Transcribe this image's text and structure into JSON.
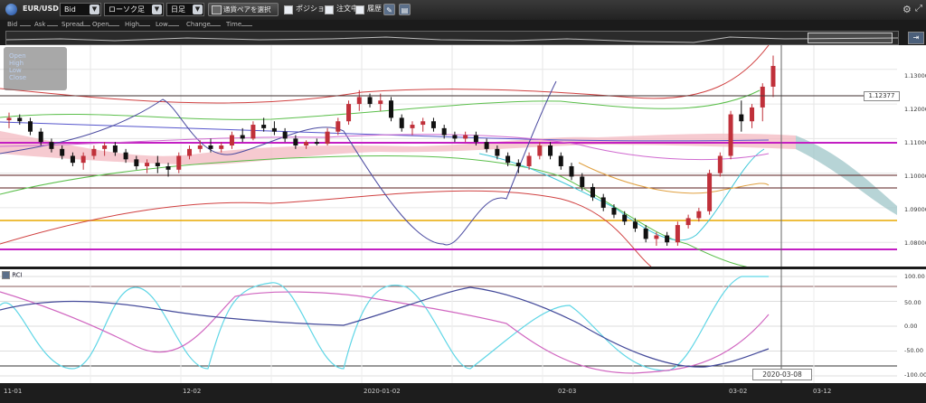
{
  "toolbar": {
    "pair": "EUR/USD",
    "price_type": "Bid",
    "chart_type": "ローソク足",
    "period": "日足",
    "pair_button": "通貨ペアを選択",
    "checkbox_position": "ポジション",
    "checkbox_orders": "注文中",
    "checkbox_history": "履歴"
  },
  "legend": [
    {
      "label": "Bid",
      "color": "#cccccc"
    },
    {
      "label": "Ask",
      "color": "#cccccc"
    },
    {
      "label": "Spread",
      "color": "#cccccc"
    },
    {
      "label": "Open",
      "color": "#cccccc"
    },
    {
      "label": "High",
      "color": "#cccccc"
    },
    {
      "label": "Low",
      "color": "#cccccc"
    },
    {
      "label": "Change",
      "color": "#cccccc"
    },
    {
      "label": "Time",
      "color": "#cccccc"
    }
  ],
  "ohlc_box": {
    "open": "Open",
    "high": "High",
    "low": "Low",
    "close": "Close"
  },
  "main_yaxis": [
    "1.13000",
    "1.12000",
    "1.11000",
    "1.10000",
    "1.09000",
    "1.08000"
  ],
  "current_price": "1.12377",
  "rci": {
    "label": "RCI",
    "yaxis": [
      "100.00",
      "50.00",
      "0.00",
      "-50.00",
      "-100.00"
    ]
  },
  "xaxis": [
    "11-01",
    "12-02",
    "2020-01-02",
    "02-03",
    "03-02",
    "03-12"
  ],
  "crosshair_date": "2020-03-08",
  "colors": {
    "up": "#c0303a",
    "down": "#111111",
    "cloud_pos": "#f3b8c0",
    "cloud_neg": "#9fc6c8",
    "hline_magenta": "#c31fc3",
    "hline_orange": "#e8a800",
    "hline_dark": "#5a1e1e"
  },
  "chart_data": {
    "type": "candlestick",
    "ylim": [
      1.073,
      1.137
    ],
    "candles": [
      [
        1.1153,
        1.1175,
        1.113,
        1.116
      ],
      [
        1.116,
        1.117,
        1.114,
        1.115
      ],
      [
        1.115,
        1.116,
        1.111,
        1.112
      ],
      [
        1.112,
        1.113,
        1.108,
        1.109
      ],
      [
        1.109,
        1.11,
        1.106,
        1.107
      ],
      [
        1.107,
        1.108,
        1.104,
        1.105
      ],
      [
        1.105,
        1.106,
        1.102,
        1.103
      ],
      [
        1.103,
        1.106,
        1.101,
        1.105
      ],
      [
        1.105,
        1.108,
        1.104,
        1.107
      ],
      [
        1.107,
        1.109,
        1.105,
        1.108
      ],
      [
        1.108,
        1.109,
        1.105,
        1.106
      ],
      [
        1.106,
        1.107,
        1.103,
        1.104
      ],
      [
        1.104,
        1.105,
        1.101,
        1.102
      ],
      [
        1.102,
        1.104,
        1.1,
        1.103
      ],
      [
        1.103,
        1.105,
        1.1,
        1.102
      ],
      [
        1.102,
        1.103,
        1.099,
        1.101
      ],
      [
        1.101,
        1.106,
        1.1,
        1.105
      ],
      [
        1.105,
        1.108,
        1.104,
        1.107
      ],
      [
        1.107,
        1.1095,
        1.106,
        1.108
      ],
      [
        1.108,
        1.11,
        1.106,
        1.107
      ],
      [
        1.107,
        1.109,
        1.106,
        1.108
      ],
      [
        1.108,
        1.112,
        1.107,
        1.111
      ],
      [
        1.111,
        1.113,
        1.109,
        1.11
      ],
      [
        1.11,
        1.115,
        1.1095,
        1.114
      ],
      [
        1.114,
        1.116,
        1.112,
        1.113
      ],
      [
        1.113,
        1.115,
        1.111,
        1.112
      ],
      [
        1.112,
        1.113,
        1.109,
        1.11
      ],
      [
        1.11,
        1.111,
        1.107,
        1.108
      ],
      [
        1.108,
        1.1095,
        1.107,
        1.109
      ],
      [
        1.109,
        1.11,
        1.108,
        1.1085
      ],
      [
        1.1085,
        1.113,
        1.108,
        1.112
      ],
      [
        1.112,
        1.116,
        1.111,
        1.115
      ],
      [
        1.115,
        1.121,
        1.114,
        1.12
      ],
      [
        1.12,
        1.124,
        1.118,
        1.122
      ],
      [
        1.122,
        1.123,
        1.119,
        1.12
      ],
      [
        1.12,
        1.123,
        1.118,
        1.121
      ],
      [
        1.121,
        1.122,
        1.115,
        1.116
      ],
      [
        1.116,
        1.117,
        1.112,
        1.113
      ],
      [
        1.113,
        1.115,
        1.111,
        1.114
      ],
      [
        1.114,
        1.116,
        1.112,
        1.115
      ],
      [
        1.115,
        1.116,
        1.112,
        1.113
      ],
      [
        1.113,
        1.114,
        1.11,
        1.111
      ],
      [
        1.111,
        1.112,
        1.109,
        1.11
      ],
      [
        1.11,
        1.112,
        1.109,
        1.111
      ],
      [
        1.111,
        1.112,
        1.108,
        1.109
      ],
      [
        1.109,
        1.11,
        1.106,
        1.107
      ],
      [
        1.107,
        1.108,
        1.104,
        1.105
      ],
      [
        1.105,
        1.106,
        1.102,
        1.103
      ],
      [
        1.103,
        1.104,
        1.1,
        1.102
      ],
      [
        1.102,
        1.106,
        1.101,
        1.105
      ],
      [
        1.105,
        1.109,
        1.104,
        1.108
      ],
      [
        1.108,
        1.109,
        1.104,
        1.105
      ],
      [
        1.105,
        1.106,
        1.101,
        1.102
      ],
      [
        1.102,
        1.103,
        1.098,
        1.099
      ],
      [
        1.099,
        1.1,
        1.095,
        1.096
      ],
      [
        1.096,
        1.097,
        1.092,
        1.093
      ],
      [
        1.093,
        1.094,
        1.089,
        1.09
      ],
      [
        1.09,
        1.091,
        1.087,
        1.088
      ],
      [
        1.088,
        1.089,
        1.085,
        1.086
      ],
      [
        1.086,
        1.087,
        1.083,
        1.084
      ],
      [
        1.084,
        1.085,
        1.08,
        1.081
      ],
      [
        1.081,
        1.083,
        1.079,
        1.082
      ],
      [
        1.082,
        1.083,
        1.079,
        1.08
      ],
      [
        1.08,
        1.086,
        1.079,
        1.085
      ],
      [
        1.085,
        1.088,
        1.084,
        1.087
      ],
      [
        1.087,
        1.09,
        1.086,
        1.089
      ],
      [
        1.089,
        1.101,
        1.088,
        1.1
      ],
      [
        1.1,
        1.106,
        1.099,
        1.105
      ],
      [
        1.105,
        1.118,
        1.104,
        1.117
      ],
      [
        1.117,
        1.121,
        1.112,
        1.115
      ],
      [
        1.115,
        1.12,
        1.113,
        1.119
      ],
      [
        1.119,
        1.126,
        1.115,
        1.125
      ],
      [
        1.125,
        1.134,
        1.122,
        1.131
      ]
    ]
  }
}
